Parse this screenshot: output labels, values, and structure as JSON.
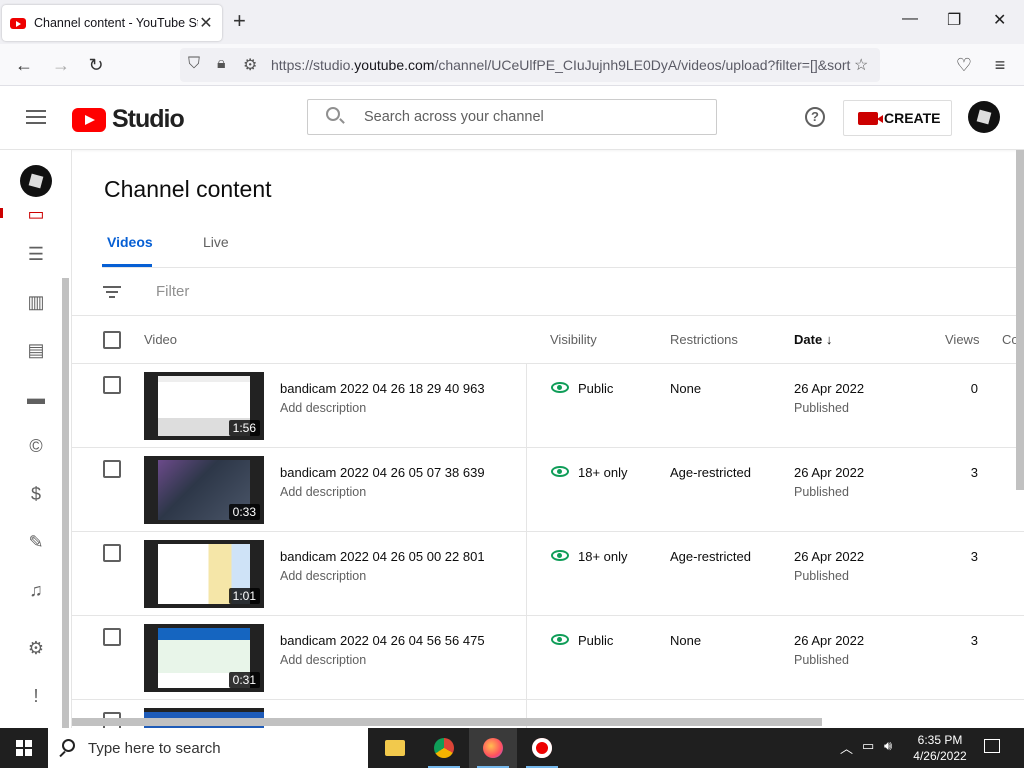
{
  "browser": {
    "tab_title": "Channel content - YouTube Stu",
    "tab_close": "✕",
    "new_tab": "+",
    "url_prefix": "https://studio.",
    "url_host": "youtube.com",
    "url_rest": "/channel/UCeUlfPE_CIuJujnh9LE0DyA/videos/upload?filter=[]&sort",
    "win_minimize": "—",
    "win_maximize": "❐",
    "win_close": "✕"
  },
  "studio": {
    "logo_text": "Studio",
    "search_placeholder": "Search across your channel",
    "help": "?",
    "create_label": "CREATE"
  },
  "page": {
    "title": "Channel content",
    "tabs": [
      {
        "label": "Videos",
        "active": true
      },
      {
        "label": "Live",
        "active": false
      }
    ],
    "filter_placeholder": "Filter"
  },
  "table": {
    "headers": {
      "video": "Video",
      "visibility": "Visibility",
      "restrictions": "Restrictions",
      "date": "Date",
      "sort_arrow": "↓",
      "views": "Views",
      "comments": "Co"
    },
    "rows": [
      {
        "title": "bandicam 2022 04 26 18 29 40 963",
        "desc": "Add description",
        "duration": "1:56",
        "visibility": "Public",
        "restrictions": "None",
        "date": "26 Apr 2022",
        "status": "Published",
        "views": "0"
      },
      {
        "title": "bandicam 2022 04 26 05 07 38 639",
        "desc": "Add description",
        "duration": "0:33",
        "visibility": "18+ only",
        "restrictions": "Age-restricted",
        "date": "26 Apr 2022",
        "status": "Published",
        "views": "3"
      },
      {
        "title": "bandicam 2022 04 26 05 00 22 801",
        "desc": "Add description",
        "duration": "1:01",
        "visibility": "18+ only",
        "restrictions": "Age-restricted",
        "date": "26 Apr 2022",
        "status": "Published",
        "views": "3"
      },
      {
        "title": "bandicam 2022 04 26 04 56 56 475",
        "desc": "Add description",
        "duration": "0:31",
        "visibility": "Public",
        "restrictions": "None",
        "date": "26 Apr 2022",
        "status": "Published",
        "views": "3"
      }
    ]
  },
  "taskbar": {
    "search_placeholder": "Type here to search",
    "time": "6:35 PM",
    "date": "4/26/2022"
  },
  "colors": {
    "brand_red": "#ff0000",
    "accent_blue": "#065fd4",
    "public_green": "#0f9d58"
  }
}
